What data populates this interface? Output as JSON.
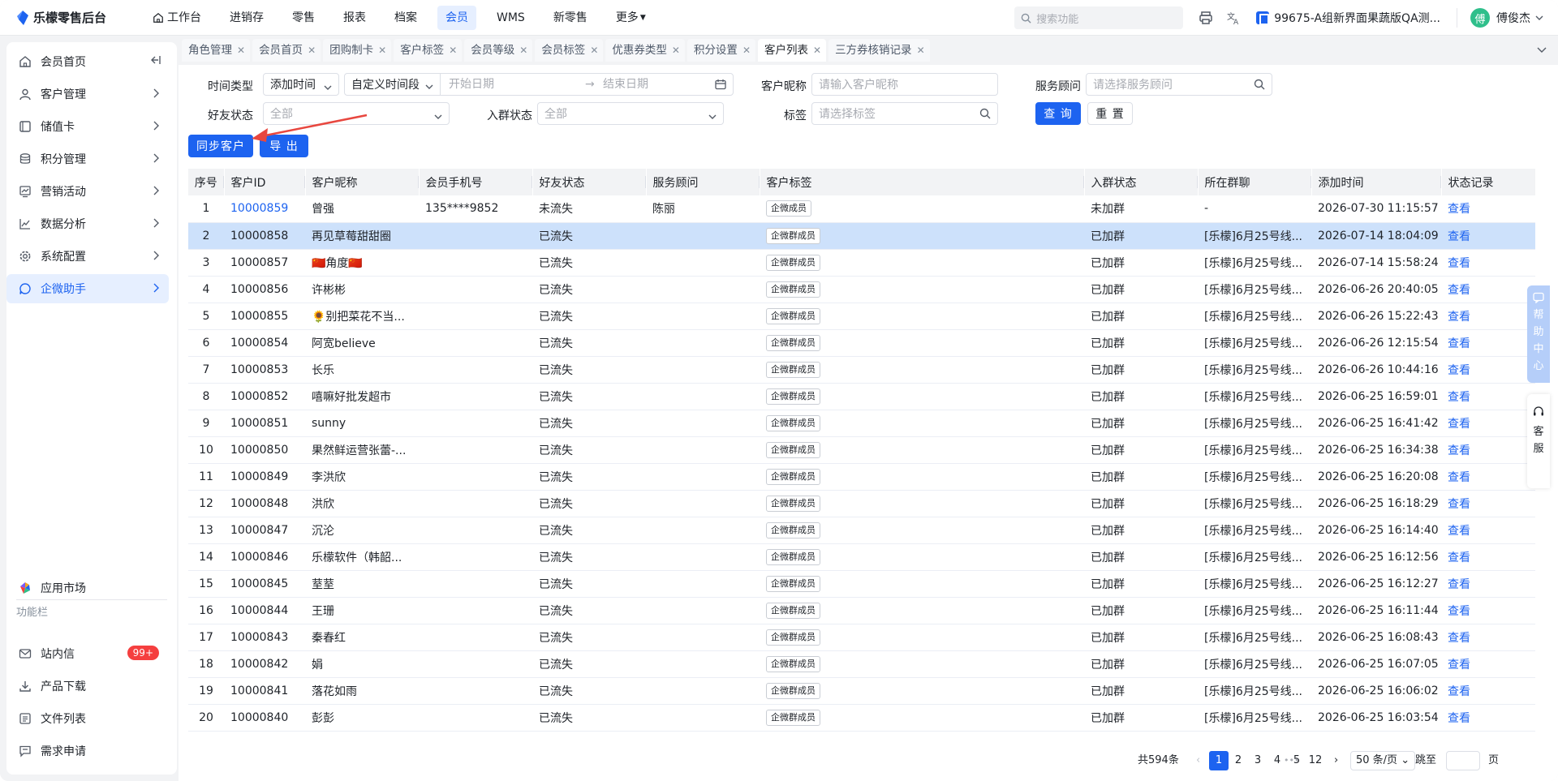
{
  "app": {
    "title": "乐檬零售后台"
  },
  "nav": [
    {
      "label": "工作台",
      "icon": "home-icon"
    },
    {
      "label": "进销存"
    },
    {
      "label": "零售"
    },
    {
      "label": "报表"
    },
    {
      "label": "档案"
    },
    {
      "label": "会员",
      "active": true
    },
    {
      "label": "WMS"
    },
    {
      "label": "新零售"
    },
    {
      "label": "更多"
    }
  ],
  "topbar": {
    "search_placeholder": "搜索功能",
    "store": "99675-A组新界面果蔬版QA测...",
    "avatar_text": "傅",
    "username": "傅俊杰"
  },
  "sidebar": {
    "items": [
      {
        "label": "会员首页",
        "icon": "home-icon"
      },
      {
        "label": "客户管理",
        "icon": "user-icon"
      },
      {
        "label": "储值卡",
        "icon": "card-icon"
      },
      {
        "label": "积分管理",
        "icon": "coins-icon"
      },
      {
        "label": "营销活动",
        "icon": "chart-icon"
      },
      {
        "label": "数据分析",
        "icon": "trend-icon"
      },
      {
        "label": "系统配置",
        "icon": "gear-icon"
      },
      {
        "label": "企微助手",
        "icon": "chat-icon"
      }
    ],
    "app_market": "应用市场",
    "section_title": "功能栏",
    "tools": [
      {
        "label": "站内信",
        "badge": "99+"
      },
      {
        "label": "产品下载"
      },
      {
        "label": "文件列表"
      },
      {
        "label": "需求申请"
      }
    ]
  },
  "tabs": [
    "角色管理",
    "会员首页",
    "团购制卡",
    "客户标签",
    "会员等级",
    "会员标签",
    "优惠券类型",
    "积分设置",
    "客户列表",
    "三方券核销记录"
  ],
  "active_tab": "客户列表",
  "filters": {
    "time_type_label": "时间类型",
    "time_type_value": "添加时间",
    "period_value": "自定义时间段",
    "start_placeholder": "开始日期",
    "end_placeholder": "结束日期",
    "nickname_label": "客户昵称",
    "nickname_placeholder": "请输入客户昵称",
    "advisor_label": "服务顾问",
    "advisor_placeholder": "请选择服务顾问",
    "friend_label": "好友状态",
    "friend_placeholder": "全部",
    "group_label": "入群状态",
    "group_placeholder": "全部",
    "tag_label": "标签",
    "tag_placeholder": "请选择标签",
    "query_btn": "查 询",
    "reset_btn": "重 置"
  },
  "actions": {
    "sync": "同步客户",
    "export": "导 出"
  },
  "table": {
    "columns": [
      "序号",
      "客户ID",
      "客户昵称",
      "会员手机号",
      "好友状态",
      "服务顾问",
      "客户标签",
      "入群状态",
      "所在群聊",
      "添加时间",
      "状态记录"
    ],
    "rows": [
      {
        "no": "1",
        "id": "10000859",
        "nick": "曾强",
        "phone": "135****9852",
        "friend": "未流失",
        "advisor": "陈丽",
        "tag": "企微成员",
        "group": "未加群",
        "chat": "-",
        "time": "2026-07-30 11:15:57",
        "action": "查看",
        "id_link": true
      },
      {
        "no": "2",
        "id": "10000858",
        "nick": "再见草莓甜甜圈",
        "phone": "",
        "friend": "已流失",
        "advisor": "",
        "tag": "企微群成员",
        "group": "已加群",
        "chat": "[乐檬]6月25号线...",
        "time": "2026-07-14 18:04:09",
        "action": "查看",
        "selected": true
      },
      {
        "no": "3",
        "id": "10000857",
        "nick": "🇨🇳角度🇨🇳",
        "phone": "",
        "friend": "已流失",
        "advisor": "",
        "tag": "企微群成员",
        "group": "已加群",
        "chat": "[乐檬]6月25号线...",
        "time": "2026-07-14 15:58:24",
        "action": "查看"
      },
      {
        "no": "4",
        "id": "10000856",
        "nick": "许彬彬",
        "phone": "",
        "friend": "已流失",
        "advisor": "",
        "tag": "企微群成员",
        "group": "已加群",
        "chat": "[乐檬]6月25号线...",
        "time": "2026-06-26 20:40:05",
        "action": "查看"
      },
      {
        "no": "5",
        "id": "10000855",
        "nick": "🌻别把菜花不当...",
        "phone": "",
        "friend": "已流失",
        "advisor": "",
        "tag": "企微群成员",
        "group": "已加群",
        "chat": "[乐檬]6月25号线...",
        "time": "2026-06-26 15:22:43",
        "action": "查看"
      },
      {
        "no": "6",
        "id": "10000854",
        "nick": "阿宽believe",
        "phone": "",
        "friend": "已流失",
        "advisor": "",
        "tag": "企微群成员",
        "group": "已加群",
        "chat": "[乐檬]6月25号线...",
        "time": "2026-06-26 12:15:54",
        "action": "查看"
      },
      {
        "no": "7",
        "id": "10000853",
        "nick": "长乐",
        "phone": "",
        "friend": "已流失",
        "advisor": "",
        "tag": "企微群成员",
        "group": "已加群",
        "chat": "[乐檬]6月25号线...",
        "time": "2026-06-26 10:44:16",
        "action": "查看"
      },
      {
        "no": "8",
        "id": "10000852",
        "nick": "嘻嘛好批发超市",
        "phone": "",
        "friend": "已流失",
        "advisor": "",
        "tag": "企微群成员",
        "group": "已加群",
        "chat": "[乐檬]6月25号线...",
        "time": "2026-06-25 16:59:01",
        "action": "查看"
      },
      {
        "no": "9",
        "id": "10000851",
        "nick": "sunny",
        "phone": "",
        "friend": "已流失",
        "advisor": "",
        "tag": "企微群成员",
        "group": "已加群",
        "chat": "[乐檬]6月25号线...",
        "time": "2026-06-25 16:41:42",
        "action": "查看"
      },
      {
        "no": "10",
        "id": "10000850",
        "nick": "果然鲜运营张蕾-...",
        "phone": "",
        "friend": "已流失",
        "advisor": "",
        "tag": "企微群成员",
        "group": "已加群",
        "chat": "[乐檬]6月25号线...",
        "time": "2026-06-25 16:34:38",
        "action": "查看"
      },
      {
        "no": "11",
        "id": "10000849",
        "nick": "李洪欣",
        "phone": "",
        "friend": "已流失",
        "advisor": "",
        "tag": "企微群成员",
        "group": "已加群",
        "chat": "[乐檬]6月25号线...",
        "time": "2026-06-25 16:20:08",
        "action": "查看"
      },
      {
        "no": "12",
        "id": "10000848",
        "nick": "洪欣",
        "phone": "",
        "friend": "已流失",
        "advisor": "",
        "tag": "企微群成员",
        "group": "已加群",
        "chat": "[乐檬]6月25号线...",
        "time": "2026-06-25 16:18:29",
        "action": "查看"
      },
      {
        "no": "13",
        "id": "10000847",
        "nick": "沉沦",
        "phone": "",
        "friend": "已流失",
        "advisor": "",
        "tag": "企微群成员",
        "group": "已加群",
        "chat": "[乐檬]6月25号线...",
        "time": "2026-06-25 16:14:40",
        "action": "查看"
      },
      {
        "no": "14",
        "id": "10000846",
        "nick": "乐檬软件（韩韶...",
        "phone": "",
        "friend": "已流失",
        "advisor": "",
        "tag": "企微群成员",
        "group": "已加群",
        "chat": "[乐檬]6月25号线...",
        "time": "2026-06-25 16:12:56",
        "action": "查看"
      },
      {
        "no": "15",
        "id": "10000845",
        "nick": "荎荎",
        "phone": "",
        "friend": "已流失",
        "advisor": "",
        "tag": "企微群成员",
        "group": "已加群",
        "chat": "[乐檬]6月25号线...",
        "time": "2026-06-25 16:12:27",
        "action": "查看"
      },
      {
        "no": "16",
        "id": "10000844",
        "nick": "王珊",
        "phone": "",
        "friend": "已流失",
        "advisor": "",
        "tag": "企微群成员",
        "group": "已加群",
        "chat": "[乐檬]6月25号线...",
        "time": "2026-06-25 16:11:44",
        "action": "查看"
      },
      {
        "no": "17",
        "id": "10000843",
        "nick": "秦春红",
        "phone": "",
        "friend": "已流失",
        "advisor": "",
        "tag": "企微群成员",
        "group": "已加群",
        "chat": "[乐檬]6月25号线...",
        "time": "2026-06-25 16:08:43",
        "action": "查看"
      },
      {
        "no": "18",
        "id": "10000842",
        "nick": "娟",
        "phone": "",
        "friend": "已流失",
        "advisor": "",
        "tag": "企微群成员",
        "group": "已加群",
        "chat": "[乐檬]6月25号线...",
        "time": "2026-06-25 16:07:05",
        "action": "查看"
      },
      {
        "no": "19",
        "id": "10000841",
        "nick": "落花如雨",
        "phone": "",
        "friend": "已流失",
        "advisor": "",
        "tag": "企微群成员",
        "group": "已加群",
        "chat": "[乐檬]6月25号线...",
        "time": "2026-06-25 16:06:02",
        "action": "查看"
      },
      {
        "no": "20",
        "id": "10000840",
        "nick": "彭彭",
        "phone": "",
        "friend": "已流失",
        "advisor": "",
        "tag": "企微群成员",
        "group": "已加群",
        "chat": "[乐檬]6月25号线...",
        "time": "2026-06-25 16:03:54",
        "action": "查看"
      }
    ]
  },
  "pagination": {
    "total": "共594条",
    "pages": [
      "1",
      "2",
      "3",
      "4",
      "5"
    ],
    "ellipsis": "•••",
    "last": "12",
    "current": "1",
    "page_size": "50 条/页",
    "jump_label": "跳至",
    "page_suffix": "页"
  },
  "floating": {
    "help": "帮助中心",
    "service": "客服"
  },
  "colors": {
    "primary": "#1d63f0",
    "selected_row": "#cde1fb",
    "badge": "#f53f3f",
    "arrow": "#e8473f"
  }
}
